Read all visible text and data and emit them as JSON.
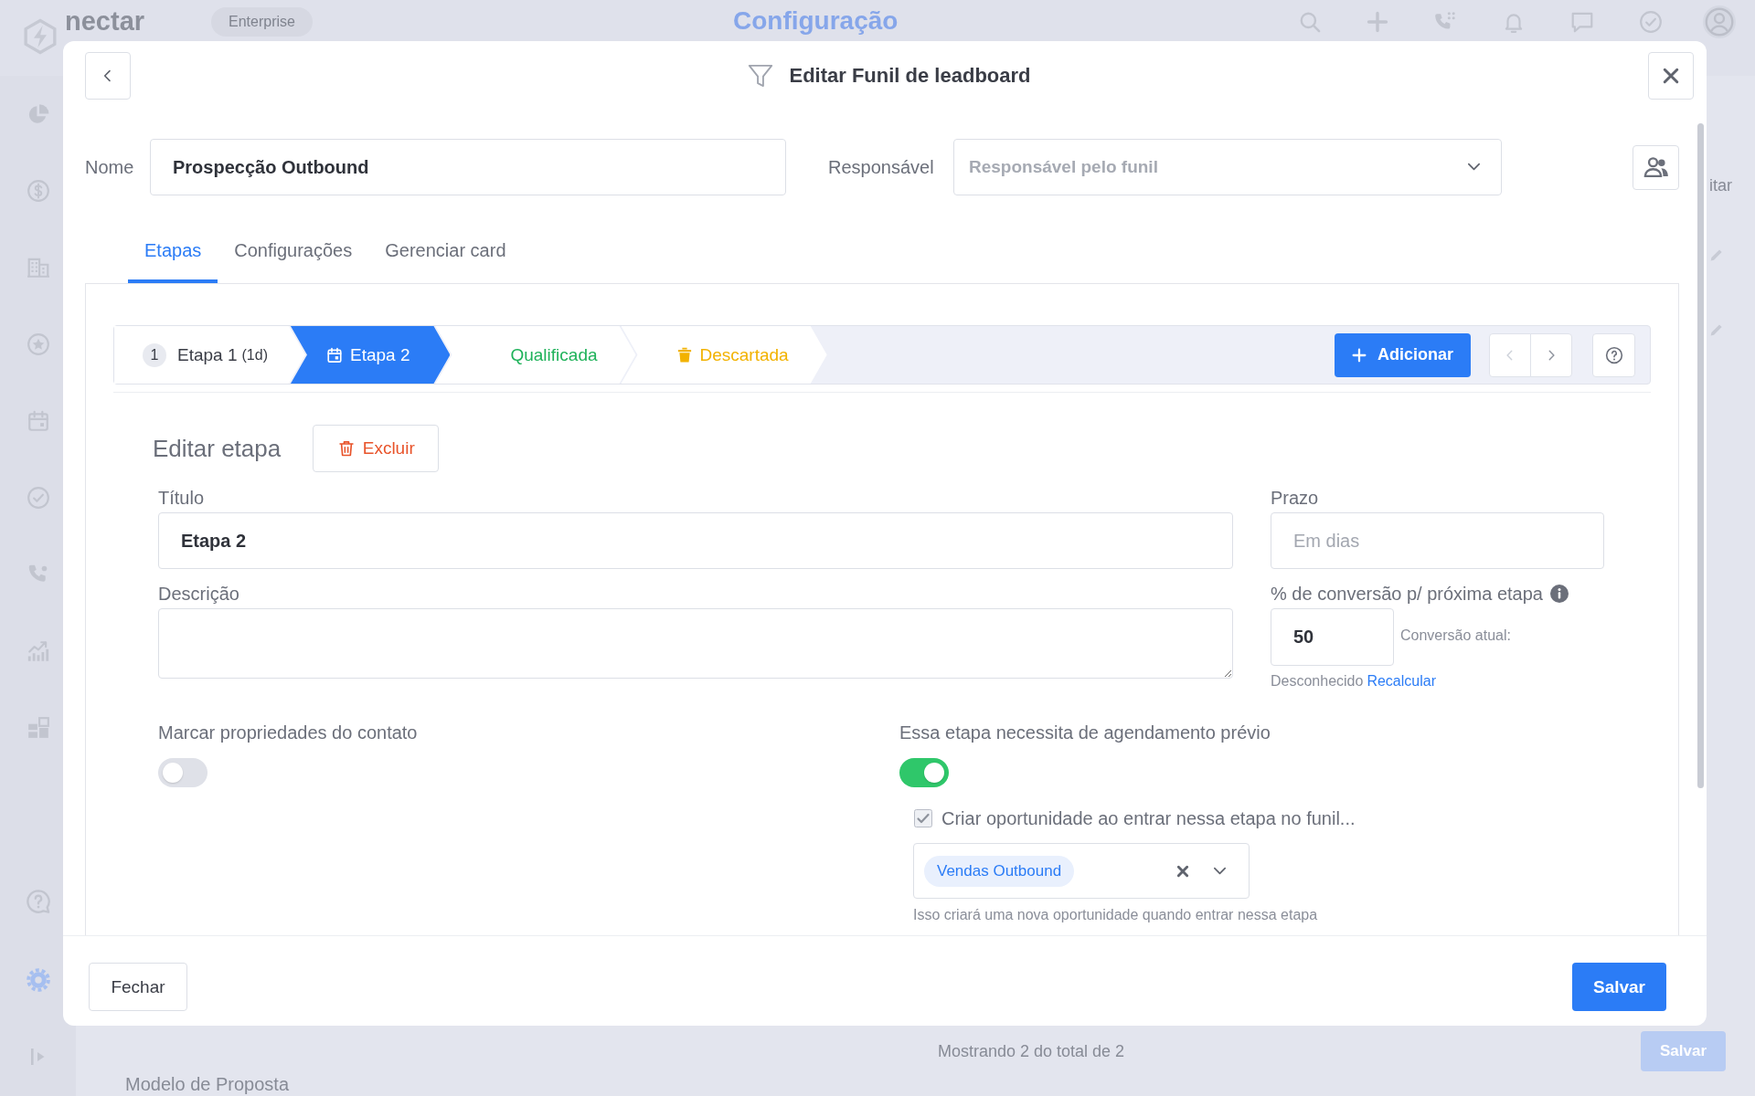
{
  "background": {
    "logo": "nectar",
    "plan_badge": "Enterprise",
    "page_title": "Configuração",
    "sidebar": {
      "top_items": [
        {
          "selected": false
        },
        {
          "selected": false
        },
        {
          "selected": false
        },
        {
          "selected": false
        },
        {
          "selected": false
        },
        {
          "selected": false
        },
        {
          "selected": false
        },
        {
          "selected": false
        },
        {
          "selected": false
        }
      ],
      "bottom_items": [
        {
          "selected": false
        },
        {
          "selected": true
        }
      ]
    },
    "row_action": "itar",
    "pagination": "Mostrando 2 do total de 2",
    "save_button": "Salvar",
    "row_title": "Modelo de Proposta"
  },
  "modal": {
    "title": "Editar Funil de leadboard",
    "name_field": {
      "label": "Nome",
      "value": "Prospecção Outbound"
    },
    "owner_field": {
      "label": "Responsável",
      "placeholder": "Responsável pelo funil"
    },
    "tabs": [
      {
        "label": "Etapas",
        "selected": true
      },
      {
        "label": "Configurações",
        "selected": false
      },
      {
        "label": "Gerenciar card",
        "selected": false
      }
    ],
    "stages": [
      {
        "kind": "numbered",
        "number": "1",
        "label": "Etapa 1",
        "duration": "(1d)",
        "selected": false
      },
      {
        "kind": "scheduled",
        "label": "Etapa 2",
        "selected": true
      },
      {
        "kind": "won",
        "label": "Qualificada",
        "selected": false
      },
      {
        "kind": "lost",
        "label": "Descartada",
        "selected": false
      }
    ],
    "add_button": "Adicionar",
    "pager": [
      {
        "kind": "previous",
        "disabled": true
      },
      {
        "kind": "next",
        "disabled": false
      }
    ],
    "editor": {
      "heading": "Editar etapa",
      "delete_button": "Excluir",
      "title_field": {
        "label": "Título",
        "value": "Etapa 2"
      },
      "deadline_field": {
        "label": "Prazo",
        "placeholder": "Em dias"
      },
      "description_field": {
        "label": "Descrição"
      },
      "conversion_field": {
        "label": "% de conversão p/ próxima etapa",
        "value": "50",
        "current_label": "Conversão atual:",
        "current_value": "Desconhecido",
        "recalculate_link": "Recalcular"
      },
      "mark_properties": {
        "label": "Marcar propriedades do contato",
        "on": false
      },
      "requires_scheduling": {
        "label": "Essa etapa necessita de agendamento prévio",
        "on": true
      },
      "create_opportunity": {
        "label": "Criar oportunidade ao entrar nessa etapa no funil...",
        "checked": true,
        "funnel": "Vendas Outbound",
        "hint": "Isso criará uma nova oportunidade quando entrar nessa etapa"
      }
    },
    "footer": {
      "close_button": "Fechar",
      "save_button": "Salvar"
    }
  }
}
